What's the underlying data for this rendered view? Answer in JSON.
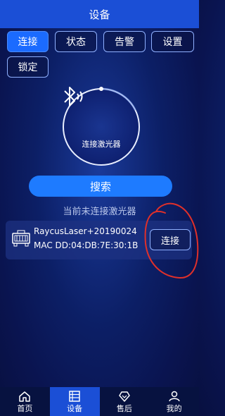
{
  "header": {
    "title": "设备"
  },
  "tabs": [
    {
      "label": "连接",
      "active": true
    },
    {
      "label": "状态",
      "active": false
    },
    {
      "label": "告警",
      "active": false
    },
    {
      "label": "设置",
      "active": false
    },
    {
      "label": "锁定",
      "active": false
    }
  ],
  "ring": {
    "label": "连接激光器",
    "icon": "bluetooth-icon"
  },
  "search_button": {
    "label": "搜索"
  },
  "status_text": "当前未连接激光器",
  "device": {
    "name": "RaycusLaser+20190024",
    "mac": "MAC DD:04:DB:7E:30:1B",
    "connect_label": "连接",
    "icon": "laser-device-icon"
  },
  "bottom_nav": [
    {
      "label": "首页",
      "icon": "home-icon",
      "active": false
    },
    {
      "label": "设备",
      "icon": "device-list-icon",
      "active": true
    },
    {
      "label": "售后",
      "icon": "service-icon",
      "active": false
    },
    {
      "label": "我的",
      "icon": "user-icon",
      "active": false
    }
  ],
  "colors": {
    "accent": "#1b6bff",
    "header": "#1b4fd6",
    "annotation": "#e0302a"
  }
}
